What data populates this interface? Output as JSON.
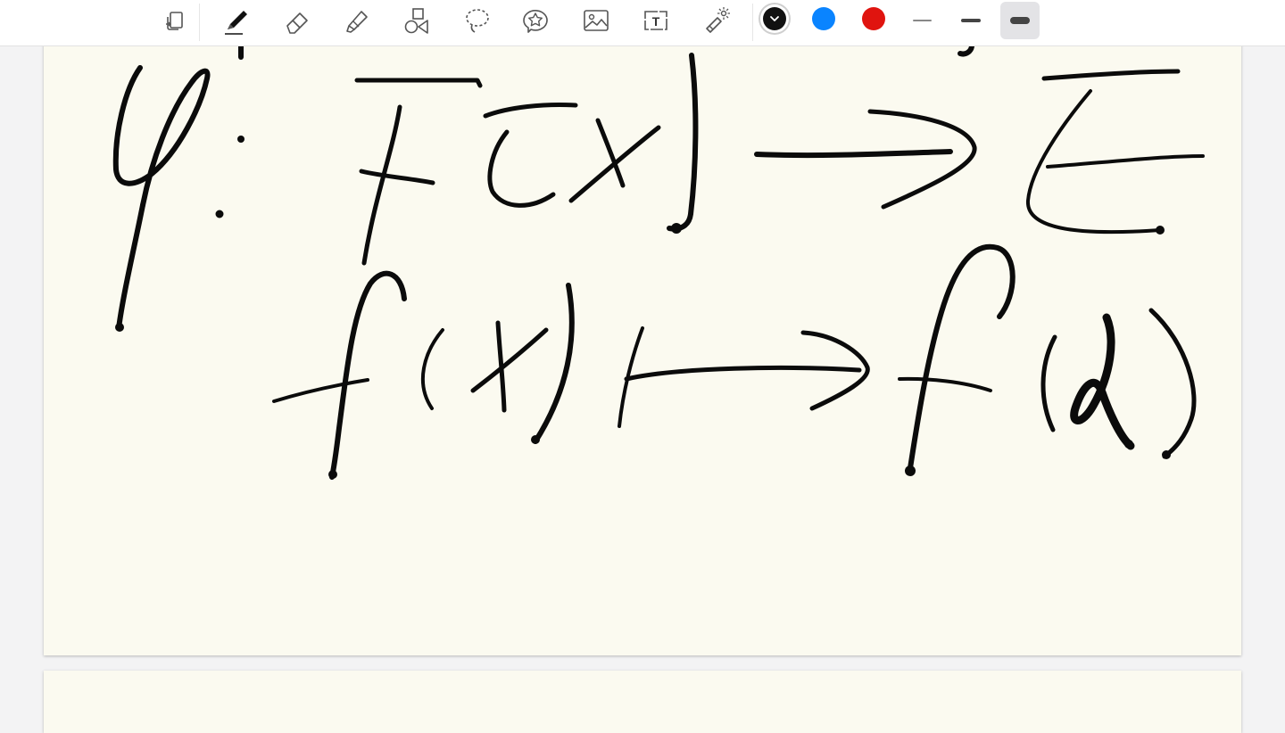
{
  "app": {
    "toolbar": {
      "tools": [
        {
          "name": "page-layout-icon"
        },
        {
          "name": "pen-icon",
          "selected": true
        },
        {
          "name": "eraser-icon"
        },
        {
          "name": "highlighter-icon"
        },
        {
          "name": "shapes-icon"
        },
        {
          "name": "lasso-icon"
        },
        {
          "name": "sticker-icon"
        },
        {
          "name": "image-icon"
        },
        {
          "name": "text-box-icon"
        },
        {
          "name": "laser-pointer-icon"
        }
      ],
      "colors": [
        {
          "name": "black",
          "hex": "#111111",
          "selected": true
        },
        {
          "name": "blue",
          "hex": "#0a84ff"
        },
        {
          "name": "red",
          "hex": "#e0140f"
        }
      ],
      "stroke_widths": [
        {
          "name": "thin"
        },
        {
          "name": "medium"
        },
        {
          "name": "thick",
          "selected": true
        }
      ],
      "text_tool_glyph": "T"
    }
  }
}
